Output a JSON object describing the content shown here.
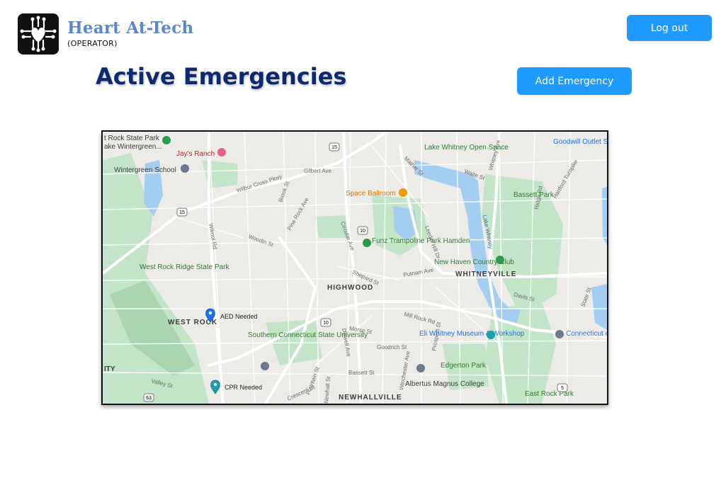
{
  "header": {
    "brand_name": "Heart At-Tech",
    "brand_role": "(OPERATOR)",
    "logout_label": "Log out",
    "logo_icon": "heart-circuit-icon"
  },
  "main": {
    "title": "Active Emergencies",
    "add_label": "Add Emergency"
  },
  "map": {
    "markers": [
      {
        "label": "AED Needed",
        "icon": "map-pin-icon",
        "color": "#1a73e8"
      },
      {
        "label": "CPR Needed",
        "icon": "map-pin-icon",
        "color": "#1a9fb0"
      }
    ],
    "places": [
      "t Rock State Park",
      "ake Wintergreen...",
      "Jay's Ranch",
      "Wintergreen School",
      "Lake Whitney Open Space",
      "Goodwill Outlet S",
      "Space Ballroom",
      "Bassett Park",
      "Funz Trampoline Park Hamden",
      "New Haven Country Club",
      "West Rock Ridge State Park",
      "HIGHWOOD",
      "WHITNEYVILLE",
      "WEST ROCK",
      "Southern Connecticut State University",
      "Eli Whitney Museum & Workshop",
      "Connecticut of Motor Veh",
      "Edgerton Park",
      "ITY",
      "Albertus Magnus College",
      "NEWHALLVILLE",
      "East Rock Park"
    ],
    "streets": [
      "Wilbur Cross Pkwy",
      "Gilbert Ave",
      "Mather St",
      "Waite St",
      "Whitney Ave",
      "Hartford Turnpike",
      "Brook St",
      "Pine Rock Ave",
      "Circular Ave",
      "Leeder Hill Dr",
      "Lake Whitney",
      "Ridge Rd",
      "Wilmot Rd",
      "Woodin St",
      "Putnam Ave",
      "Dixwell Ave",
      "Morse St",
      "Mill Rock Rd",
      "Goodrich St",
      "Davis St",
      "State St",
      "Bassett St",
      "Prospect St",
      "Winchester Ave",
      "Valley St",
      "Crescent St",
      "Fountain St",
      "Newhall St",
      "Shepard St"
    ],
    "route_shields": [
      "15",
      "15",
      "10",
      "10",
      "63",
      "5"
    ]
  },
  "colors": {
    "accent": "#1f9bff",
    "title": "#0e2a6e",
    "brand": "#5b86c7",
    "park": "#bfe3c4",
    "water": "#9ec9f0"
  }
}
